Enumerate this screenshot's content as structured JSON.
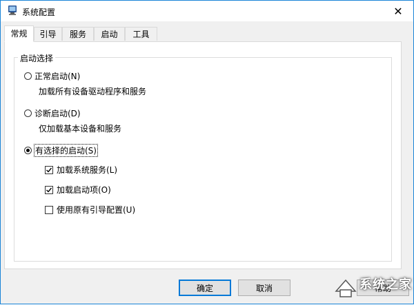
{
  "window": {
    "title": "系统配置",
    "icon": "msconfig-computer-icon",
    "close_glyph": "✕"
  },
  "tabs": [
    {
      "label": "常规",
      "active": true
    },
    {
      "label": "引导",
      "active": false
    },
    {
      "label": "服务",
      "active": false
    },
    {
      "label": "启动",
      "active": false
    },
    {
      "label": "工具",
      "active": false
    }
  ],
  "startup": {
    "group_title": "启动选择",
    "options": [
      {
        "label": "正常启动(N)",
        "description": "加载所有设备驱动程序和服务",
        "checked": false
      },
      {
        "label": "诊断启动(D)",
        "description": "仅加载基本设备和服务",
        "checked": false
      },
      {
        "label": "有选择的启动(S)",
        "checked": true
      }
    ],
    "sub_options": [
      {
        "label": "加载系统服务(L)",
        "checked": true
      },
      {
        "label": "加载启动项(O)",
        "checked": true
      },
      {
        "label": "使用原有引导配置(U)",
        "checked": false
      }
    ]
  },
  "buttons": {
    "ok": "确定",
    "cancel": "取消",
    "apply": "帮助"
  },
  "watermark": {
    "text": "系统之家"
  }
}
